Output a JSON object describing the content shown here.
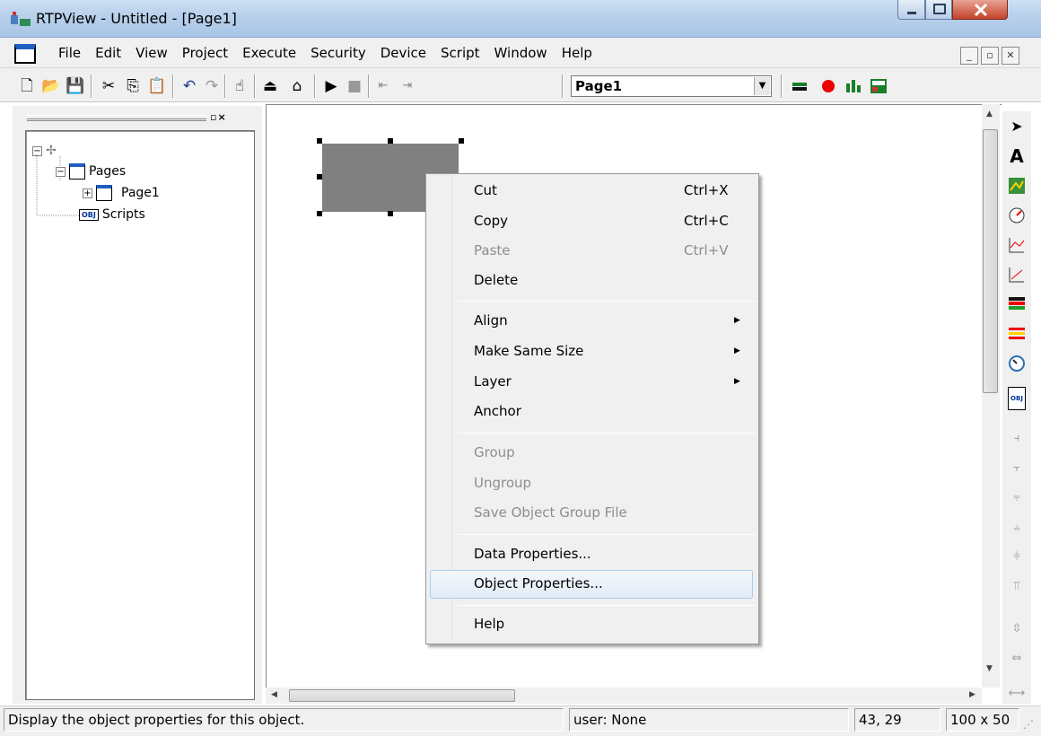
{
  "window": {
    "title": "RTPView  -  Untitled - [Page1]"
  },
  "menubar": {
    "items": [
      "File",
      "Edit",
      "View",
      "Project",
      "Execute",
      "Security",
      "Device",
      "Script",
      "Window",
      "Help"
    ]
  },
  "toolbar": {
    "page_select_value": "Page1"
  },
  "tree": {
    "root_label": "",
    "pages_label": "Pages",
    "page1_label": "Page1",
    "scripts_label": "Scripts",
    "obj_badge": "OBJ"
  },
  "context_menu": {
    "items": [
      {
        "label": "Cut",
        "shortcut": "Ctrl+X",
        "enabled": true
      },
      {
        "label": "Copy",
        "shortcut": "Ctrl+C",
        "enabled": true
      },
      {
        "label": "Paste",
        "shortcut": "Ctrl+V",
        "enabled": false
      },
      {
        "label": "Delete",
        "shortcut": "",
        "enabled": true
      },
      {
        "label": "Align",
        "submenu": true,
        "enabled": true
      },
      {
        "label": "Make Same Size",
        "submenu": true,
        "enabled": true
      },
      {
        "label": "Layer",
        "submenu": true,
        "enabled": true
      },
      {
        "label": "Anchor",
        "enabled": true
      },
      {
        "label": "Group",
        "enabled": false
      },
      {
        "label": "Ungroup",
        "enabled": false
      },
      {
        "label": "Save Object Group File",
        "enabled": false
      },
      {
        "label": "Data Properties...",
        "enabled": true
      },
      {
        "label": "Object Properties...",
        "enabled": true,
        "highlighted": true
      },
      {
        "label": "Help",
        "enabled": true
      }
    ]
  },
  "statusbar": {
    "message": "Display the object properties for this object.",
    "user": "user: None",
    "coords": "43, 29",
    "size": "100 x 50"
  },
  "colors": {
    "shape_fill": "#808080",
    "highlight_border": "#a9cbe9"
  }
}
